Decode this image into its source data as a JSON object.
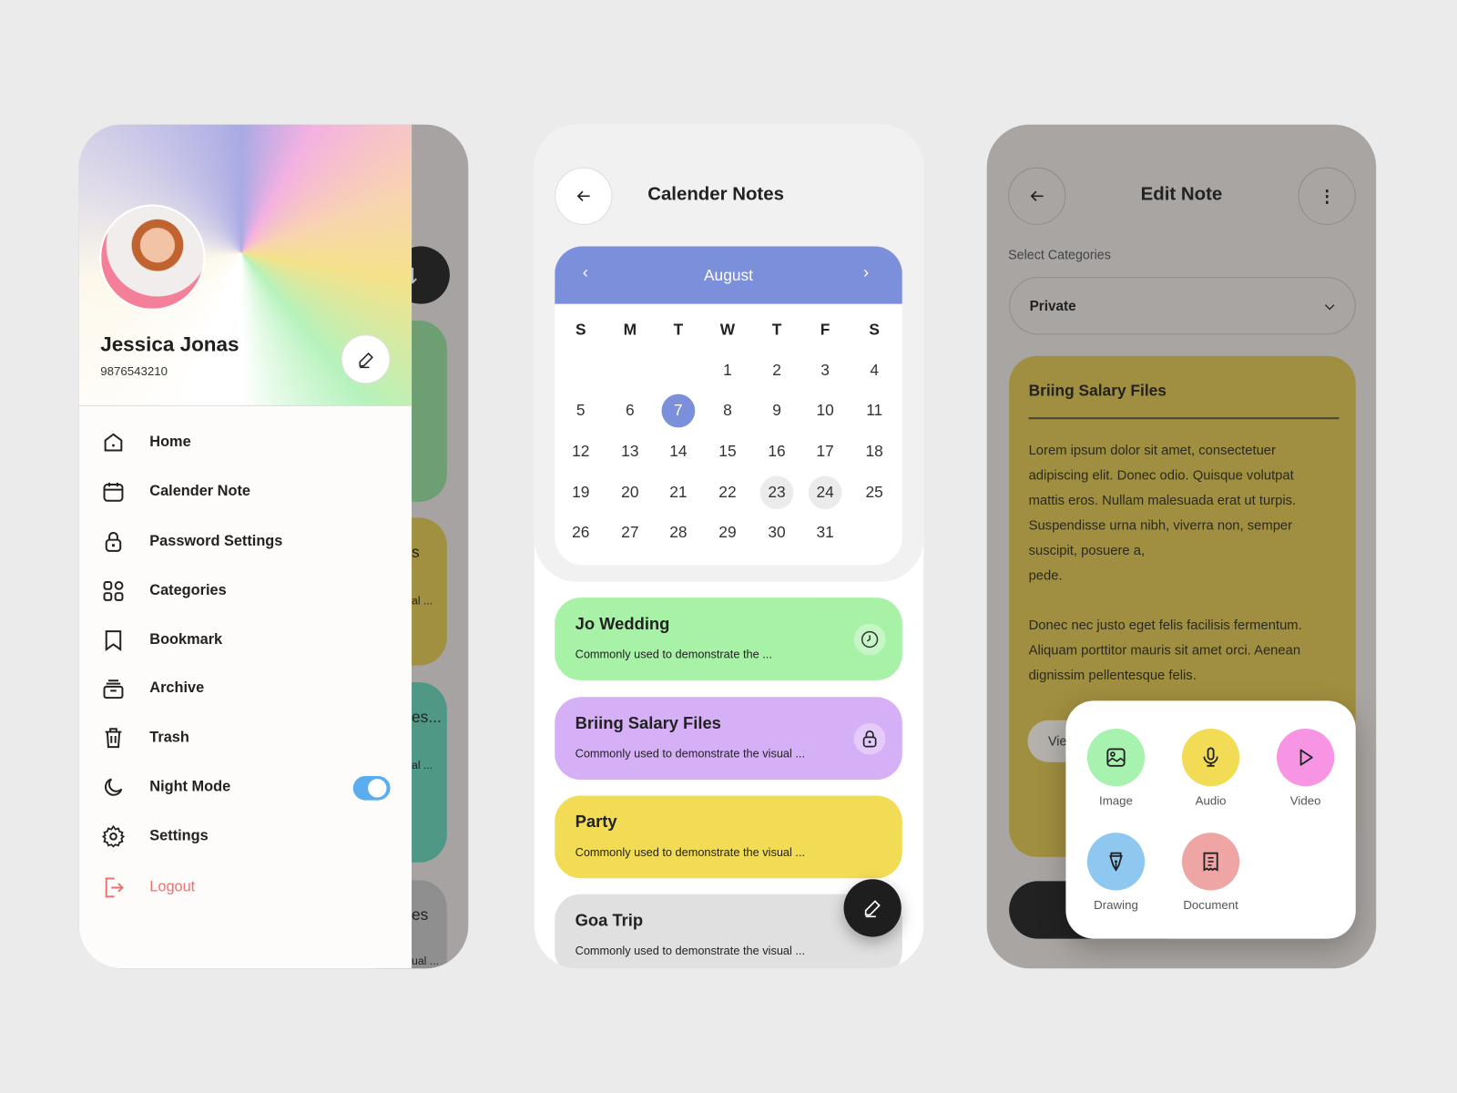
{
  "drawer": {
    "profile": {
      "name": "Jessica Jonas",
      "phone": "9876543210"
    },
    "menu": [
      {
        "label": "Home",
        "icon": "home-icon"
      },
      {
        "label": "Calender Note",
        "icon": "calendar-icon"
      },
      {
        "label": "Password Settings",
        "icon": "lock-icon"
      },
      {
        "label": "Categories",
        "icon": "grid-icon"
      },
      {
        "label": "Bookmark",
        "icon": "bookmark-icon"
      },
      {
        "label": "Archive",
        "icon": "archive-icon"
      },
      {
        "label": "Trash",
        "icon": "trash-icon"
      },
      {
        "label": "Night Mode",
        "icon": "moon-icon"
      },
      {
        "label": "Settings",
        "icon": "gear-icon"
      },
      {
        "label": "Logout",
        "icon": "logout-icon"
      }
    ],
    "night_mode_on": true,
    "background_cards": [
      "s",
      "al ...",
      "es...",
      "al ...",
      "es",
      "ual ..."
    ],
    "colors": {
      "toggle": "#5aaef0",
      "logout": "#f07070"
    }
  },
  "calendar": {
    "title": "Calender Notes",
    "month": "August",
    "weekdays": [
      "S",
      "M",
      "T",
      "W",
      "T",
      "F",
      "S"
    ],
    "weeks": [
      [
        "",
        "",
        "",
        "1",
        "2",
        "3",
        "4"
      ],
      [
        "5",
        "6",
        "7",
        "8",
        "9",
        "10",
        "11"
      ],
      [
        "12",
        "13",
        "14",
        "15",
        "16",
        "17",
        "18"
      ],
      [
        "19",
        "20",
        "21",
        "22",
        "23",
        "24",
        "25"
      ],
      [
        "26",
        "27",
        "28",
        "29",
        "30",
        "31",
        ""
      ]
    ],
    "selected_day": "7",
    "highlighted_days": [
      "23",
      "24"
    ],
    "header_color": "#7b8fdb",
    "notes": [
      {
        "title": "Jo Wedding",
        "text": "Commonly used to demonstrate the ...",
        "color": "#a8f2a8",
        "icon": "clock-icon"
      },
      {
        "title": "Briing Salary Files",
        "text": "Commonly used to demonstrate the visual ...",
        "color": "#d6b0f7",
        "icon": "lock-icon"
      },
      {
        "title": "Party",
        "text": "Commonly used to demonstrate the visual ...",
        "color": "#f3dc55",
        "icon": ""
      },
      {
        "title": "Goa Trip",
        "text": "Commonly used to demonstrate the visual ...",
        "color": "#e0e0e0",
        "icon": ""
      }
    ]
  },
  "edit": {
    "title": "Edit Note",
    "category_label": "Select Categories",
    "category_value": "Private",
    "note_title": "Briing Salary Files",
    "body_lines_1": [
      "Lorem ipsum dolor sit amet, consectetuer",
      "adipiscing elit. Donec odio. Quisque volutpat",
      "mattis eros. Nullam malesuada erat ut turpis.",
      "Suspendisse urna nibh, viverra non, semper",
      "suscipit, posuere a,",
      "pede."
    ],
    "body_lines_2": [
      "Donec nec justo eget felis facilisis fermentum.",
      "Aliquam porttitor mauris sit amet orci. Aenean",
      "dignissim pellentesque felis."
    ],
    "view_button": "Vie",
    "attach_options": [
      {
        "label": "Image",
        "icon": "image-icon",
        "color": "#a8f2b0"
      },
      {
        "label": "Audio",
        "icon": "microphone-icon",
        "color": "#f3dc55"
      },
      {
        "label": "Video",
        "icon": "play-icon",
        "color": "#f794e4"
      },
      {
        "label": "Drawing",
        "icon": "pen-nib-icon",
        "color": "#8ec8f0"
      },
      {
        "label": "Document",
        "icon": "document-icon",
        "color": "#f0a5a5"
      }
    ]
  }
}
